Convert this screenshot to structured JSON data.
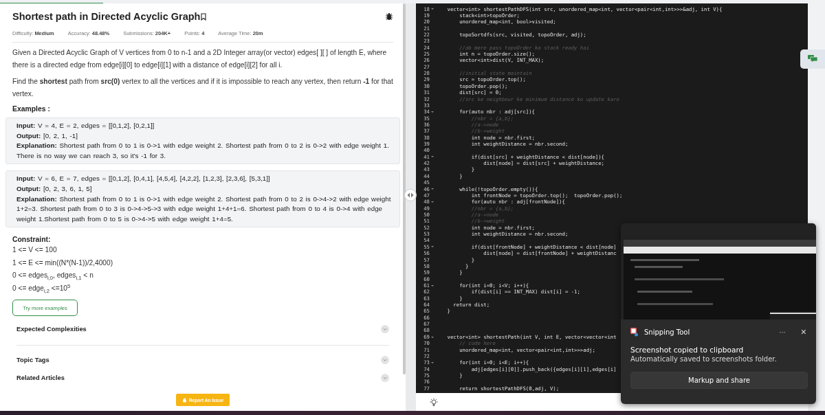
{
  "problem": {
    "title": "Shortest path in Directed Acyclic Graph",
    "meta": [
      "Difficulty: **Medium**",
      "Accuracy: **48.48%**",
      "Submissions: **204K+**",
      "Points: **4**",
      "Average Time: **20m**"
    ],
    "description": [
      "Given a Directed Acyclic Graph of V vertices from 0 to n-1 and a 2D Integer array(or vector) edges[ ][ ] of length E, where there is a directed edge from edge[i][0] to edge[i][1] with a distance of edge[i][2] for all i.",
      "Find the **shortest** path from **src(0)** vertex to all the vertices and if it is impossible to reach any vertex, then return **-1** for that vertex."
    ],
    "examples_heading": "Examples :",
    "examples": [
      [
        "**Input:** V = 4, E = 2, edges = [[0,1,2], [0,2,1]]",
        "**Output:** [0, 2, 1, -1]",
        "**Explanation:** Shortest path from 0 to 1 is 0->1 with edge weight 2. Shortest path from 0 to 2 is 0->2 with edge weight 1. There is no way we can reach 3, so it's -1 for 3."
      ],
      [
        "**Input:** V = 6, E = 7, edges = [[0,1,2], [0,4,1], [4,5,4], [4,2,2], [1,2,3], [2,3,6], [5,3,1]]",
        "**Output:** [0, 2, 3, 6, 1, 5]",
        "**Explanation:** Shortest path from 0 to 1 is 0->1 with edge weight 2. Shortest path from 0 to 2 is 0->4->2 with edge weight 1+2=3. Shortest path from 0 to 3 is 0->4->5->3 with edge weight 1+4+1=6. Shortest path from 0 to 4 is 0->4 with edge weight 1.Shortest path from 0 to 5 is 0->4->5 with edge weight 1+4=5."
      ]
    ],
    "constraint_heading": "Constraint:",
    "constraints": [
      "1 <= V <= 100",
      "1 <= E <= min((N*(N-1))/2,4000)",
      "0 <= edges$_{i,0}$, edges$_{i,1}$ < n",
      "0 <= edge$_{i,2}$ <=10$^{5}$"
    ],
    "try_button": "Try more examples",
    "sections": [
      "Expected Complexities",
      "Topic Tags",
      "Related Articles"
    ],
    "report_button": "Report An Issue"
  },
  "editor": {
    "lines": [
      {
        "number": "18",
        "text": "    vector<int> shortestPathDFS(int src, unordered_map<int, vector<pair<int,int>>>&adj, int V){",
        "kind": "code",
        "foldable": true
      },
      {
        "number": "19",
        "text": "        stack<int>topoOrder;",
        "kind": "code",
        "foldable": false
      },
      {
        "number": "20",
        "text": "        unordered_map<int, bool>visited;",
        "kind": "code",
        "foldable": false
      },
      {
        "number": "21",
        "foldable": false
      },
      {
        "number": "22",
        "text": "        topoSortdfs(src, visited, topoOrder, adj);",
        "kind": "code",
        "foldable": false
      },
      {
        "number": "23",
        "foldable": false
      },
      {
        "number": "24",
        "text": "        //ab mere pass topoOrder ka stack ready hai",
        "kind": "comment",
        "foldable": false
      },
      {
        "number": "25",
        "text": "        int n = topoOrder.size();",
        "kind": "code",
        "foldable": false
      },
      {
        "number": "26",
        "text": "        vector<int>dist(V, INT_MAX);",
        "kind": "code",
        "foldable": false
      },
      {
        "number": "27",
        "foldable": false
      },
      {
        "number": "28",
        "text": "        //initial state maintain",
        "kind": "comment",
        "foldable": false
      },
      {
        "number": "29",
        "text": "        src = topoOrder.top();",
        "kind": "code",
        "foldable": false
      },
      {
        "number": "30",
        "text": "        topoOrder.pop();",
        "kind": "code",
        "foldable": false
      },
      {
        "number": "31",
        "text": "        dist[src] = 0;",
        "kind": "code",
        "foldable": false
      },
      {
        "number": "32",
        "text": "        //src ke neighbour ke minimum distance ko update karo",
        "kind": "comment",
        "foldable": false
      },
      {
        "number": "33",
        "foldable": false
      },
      {
        "number": "34",
        "text": "        for(auto nbr : adj[src]){",
        "kind": "code",
        "foldable": true
      },
      {
        "number": "35",
        "text": "            //nbr = {a,b};",
        "kind": "comment",
        "foldable": false
      },
      {
        "number": "36",
        "text": "            //a->node",
        "kind": "comment",
        "foldable": false
      },
      {
        "number": "37",
        "text": "            //b->weight",
        "kind": "comment",
        "foldable": false
      },
      {
        "number": "38",
        "text": "            int node = nbr.first;",
        "kind": "code",
        "foldable": false
      },
      {
        "number": "39",
        "text": "            int weightDistance = nbr.second;",
        "kind": "code",
        "foldable": false
      },
      {
        "number": "40",
        "foldable": false
      },
      {
        "number": "41",
        "text": "            if(dist[src] + weightDistance < dist[node]){",
        "kind": "code",
        "foldable": true
      },
      {
        "number": "42",
        "text": "                dist[node] = dist[src] + weightDistance;",
        "kind": "code",
        "foldable": false
      },
      {
        "number": "43",
        "text": "            }",
        "kind": "code",
        "foldable": false
      },
      {
        "number": "44",
        "text": "        }",
        "kind": "code",
        "foldable": false
      },
      {
        "number": "45",
        "foldable": false
      },
      {
        "number": "46",
        "text": "        while(!topoOrder.empty()){",
        "kind": "code",
        "foldable": true
      },
      {
        "number": "47",
        "text": "            int frontNode = topoOrder.top();  topoOrder.pop();",
        "kind": "code",
        "foldable": false
      },
      {
        "number": "48",
        "text": "            for(auto nbr : adj[frontNode]){",
        "kind": "code",
        "foldable": true
      },
      {
        "number": "49",
        "text": "            //nbr = {a,b};",
        "kind": "comment",
        "foldable": false
      },
      {
        "number": "50",
        "text": "            //a->node",
        "kind": "comment",
        "foldable": false
      },
      {
        "number": "51",
        "text": "            //b->weight",
        "kind": "comment",
        "foldable": false
      },
      {
        "number": "52",
        "text": "            int node = nbr.first;",
        "kind": "code",
        "foldable": false
      },
      {
        "number": "53",
        "text": "            int weightDistance = nbr.second;",
        "kind": "code",
        "foldable": false
      },
      {
        "number": "54",
        "foldable": false
      },
      {
        "number": "55",
        "text": "            if(dist[frontNode] + weightDistance < dist[node]",
        "kind": "code",
        "foldable": true
      },
      {
        "number": "56",
        "text": "                dist[node] = dist[frontNode] + weightDistanc",
        "kind": "code",
        "foldable": false
      },
      {
        "number": "57",
        "text": "            }",
        "kind": "code",
        "foldable": false
      },
      {
        "number": "58",
        "text": "          }",
        "kind": "code",
        "foldable": false
      },
      {
        "number": "59",
        "text": "        }",
        "kind": "code",
        "foldable": false
      },
      {
        "number": "60",
        "foldable": false
      },
      {
        "number": "61",
        "text": "        for(int i=0; i<V; i++){",
        "kind": "code",
        "foldable": true
      },
      {
        "number": "62",
        "text": "            if(dist[i] == INT_MAX) dist[i] = -1;",
        "kind": "code",
        "foldable": false
      },
      {
        "number": "63",
        "text": "        }",
        "kind": "code",
        "foldable": false
      },
      {
        "number": "64",
        "text": "      return dist;",
        "kind": "code",
        "foldable": false
      },
      {
        "number": "65",
        "text": "    }",
        "kind": "code",
        "foldable": false
      },
      {
        "number": "66",
        "foldable": false
      },
      {
        "number": "67",
        "foldable": false
      },
      {
        "number": "68",
        "foldable": false
      },
      {
        "number": "69",
        "text": "    vector<int> shortestPath(int V, int E, vector<vector<int",
        "kind": "code",
        "foldable": true
      },
      {
        "number": "70",
        "text": "        // code here",
        "kind": "comment",
        "foldable": false
      },
      {
        "number": "71",
        "text": "        unordered_map<int, vector<pair<int,int>>>adj;",
        "kind": "code",
        "foldable": false
      },
      {
        "number": "72",
        "foldable": false
      },
      {
        "number": "73",
        "text": "        for(int i=0; i<E; i++){",
        "kind": "code",
        "foldable": true
      },
      {
        "number": "74",
        "text": "            adj[edges[i][0]].push_back({edges[i][1],edges[i]",
        "kind": "code",
        "foldable": false
      },
      {
        "number": "75",
        "text": "        }",
        "kind": "code",
        "foldable": false
      },
      {
        "number": "76",
        "foldable": false
      },
      {
        "number": "77",
        "text": "        return shortestPathDFS(0,adj, V);",
        "kind": "code",
        "foldable": false
      }
    ]
  },
  "toast": {
    "app": "Snipping Tool",
    "more": "···",
    "close": "×",
    "message": "Screenshot copied to clipboard",
    "detail": "Automatically saved to screenshots folder.",
    "action": "Markup and share"
  }
}
